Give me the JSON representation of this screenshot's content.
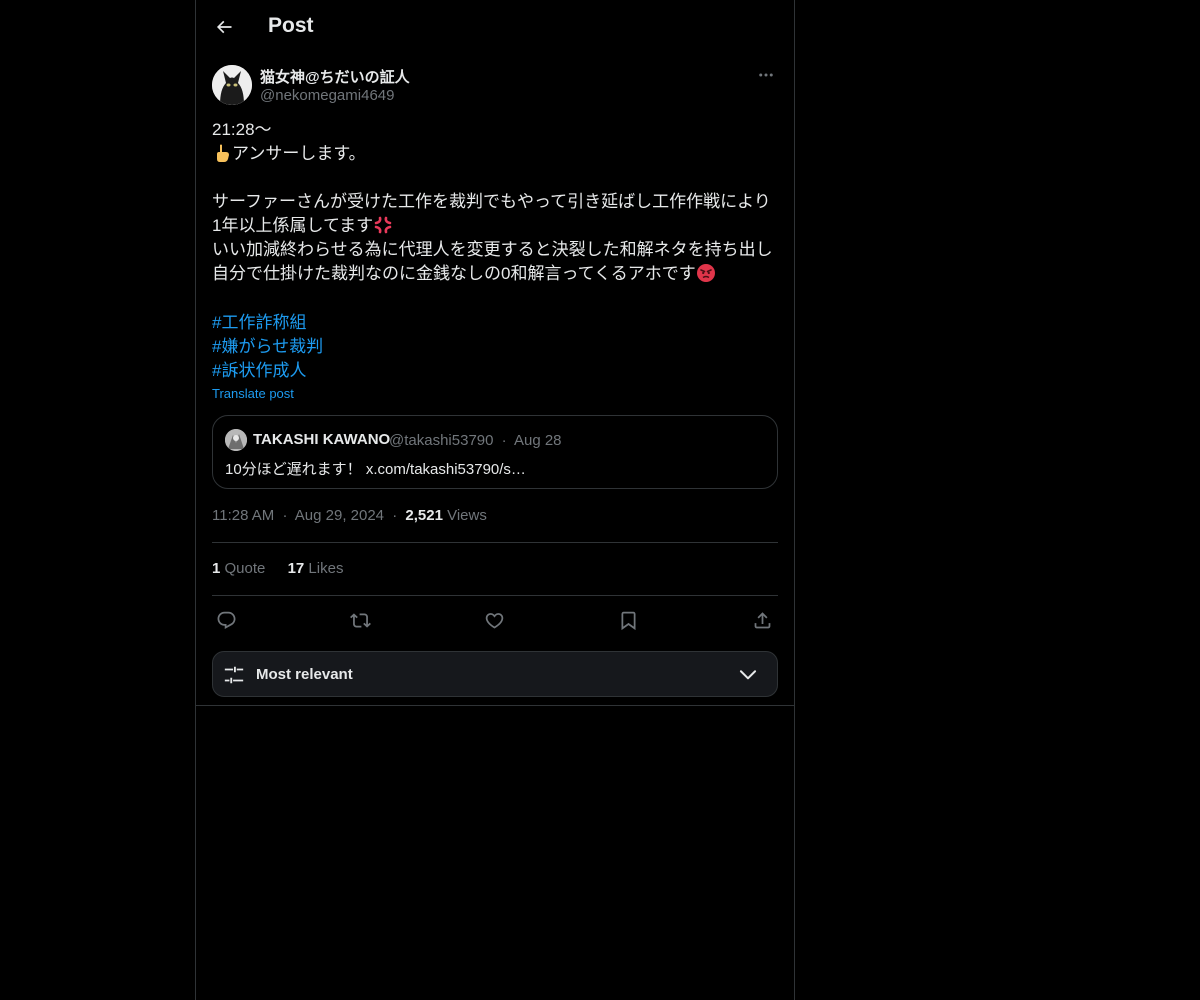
{
  "header": {
    "title": "Post"
  },
  "author": {
    "name": "猫女神@ちだいの証人",
    "handle": "@nekomegami4649"
  },
  "post": {
    "lines": [
      "21:28〜",
      "アンサーします。",
      "",
      "サーファーさんが受けた工作を裁判でもやって引き延ばし工作作戦により",
      "1年以上係属してます",
      "いい加減終わらせる為に代理人を変更すると決裂した和解ネタを持ち出し",
      "自分で仕掛けた裁判なのに金銭なしの0和解言ってくるアホです"
    ],
    "emoji": {
      "pointing_finger": "☝",
      "anger_symbol": "💢",
      "angry_face": "😡"
    },
    "hashtags": [
      "#工作詐称組",
      "#嫌がらせ裁判",
      "#訴状作成人"
    ],
    "translate_label": "Translate post"
  },
  "quote": {
    "name": "TAKASHI KAWANO",
    "handle": "@takashi53790",
    "date": "Aug 28",
    "separator": "·",
    "text": "10分ほど遅れます！ x.com/takashi53790/s…"
  },
  "meta": {
    "time": "11:28 AM",
    "date": "Aug 29, 2024",
    "separator": "·",
    "views_count": "2,521",
    "views_label": "Views"
  },
  "stats": {
    "quotes_count": "1",
    "quotes_label": "Quote",
    "likes_count": "17",
    "likes_label": "Likes"
  },
  "sort": {
    "label": "Most relevant"
  },
  "colors": {
    "background": "#000000",
    "text": "#e7e9ea",
    "muted": "#71767b",
    "link": "#1d9bf0",
    "border": "#2f3336"
  },
  "icons": {
    "back": "arrow-left-icon",
    "more": "ellipsis-icon",
    "reply": "reply-icon",
    "repost": "repost-icon",
    "like": "heart-icon",
    "bookmark": "bookmark-icon",
    "share": "share-icon",
    "sort": "sliders-icon",
    "chevron": "chevron-down-icon"
  }
}
